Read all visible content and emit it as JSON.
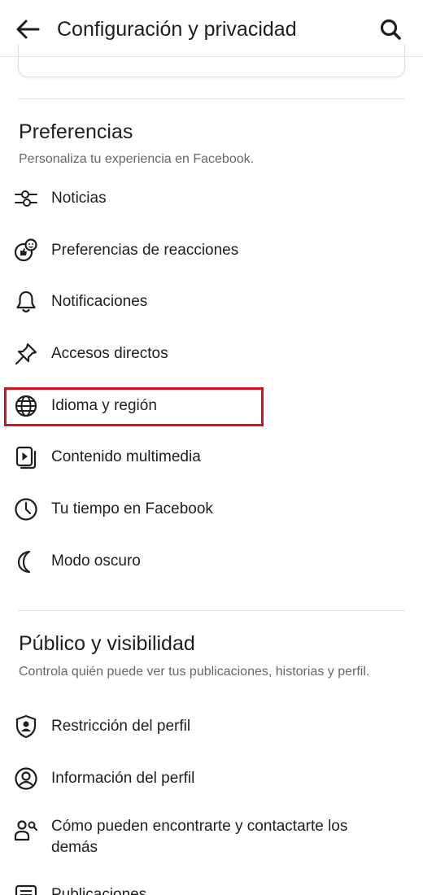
{
  "header": {
    "title": "Configuración y privacidad"
  },
  "preferences": {
    "title": "Preferencias",
    "description": "Personaliza tu experiencia en Facebook.",
    "items": [
      {
        "label": "Noticias",
        "icon": "sliders-icon"
      },
      {
        "label": "Preferencias de reacciones",
        "icon": "reactions-icon"
      },
      {
        "label": "Notificaciones",
        "icon": "bell-icon"
      },
      {
        "label": "Accesos directos",
        "icon": "pin-icon"
      },
      {
        "label": "Idioma y región",
        "icon": "globe-icon"
      },
      {
        "label": "Contenido multimedia",
        "icon": "media-icon"
      },
      {
        "label": "Tu tiempo en Facebook",
        "icon": "clock-icon"
      },
      {
        "label": "Modo oscuro",
        "icon": "moon-icon"
      }
    ]
  },
  "audience": {
    "title": "Público y visibilidad",
    "description": "Controla quién puede ver tus publicaciones, historias y perfil.",
    "items": [
      {
        "label": "Restricción del perfil",
        "icon": "shield-user-icon"
      },
      {
        "label": "Información del perfil",
        "icon": "user-circle-icon"
      },
      {
        "label": "Cómo pueden encontrarte y contactarte los demás",
        "icon": "find-people-icon"
      },
      {
        "label": "Publicaciones",
        "icon": "posts-icon"
      }
    ]
  },
  "highlight_color": "#d3111e"
}
